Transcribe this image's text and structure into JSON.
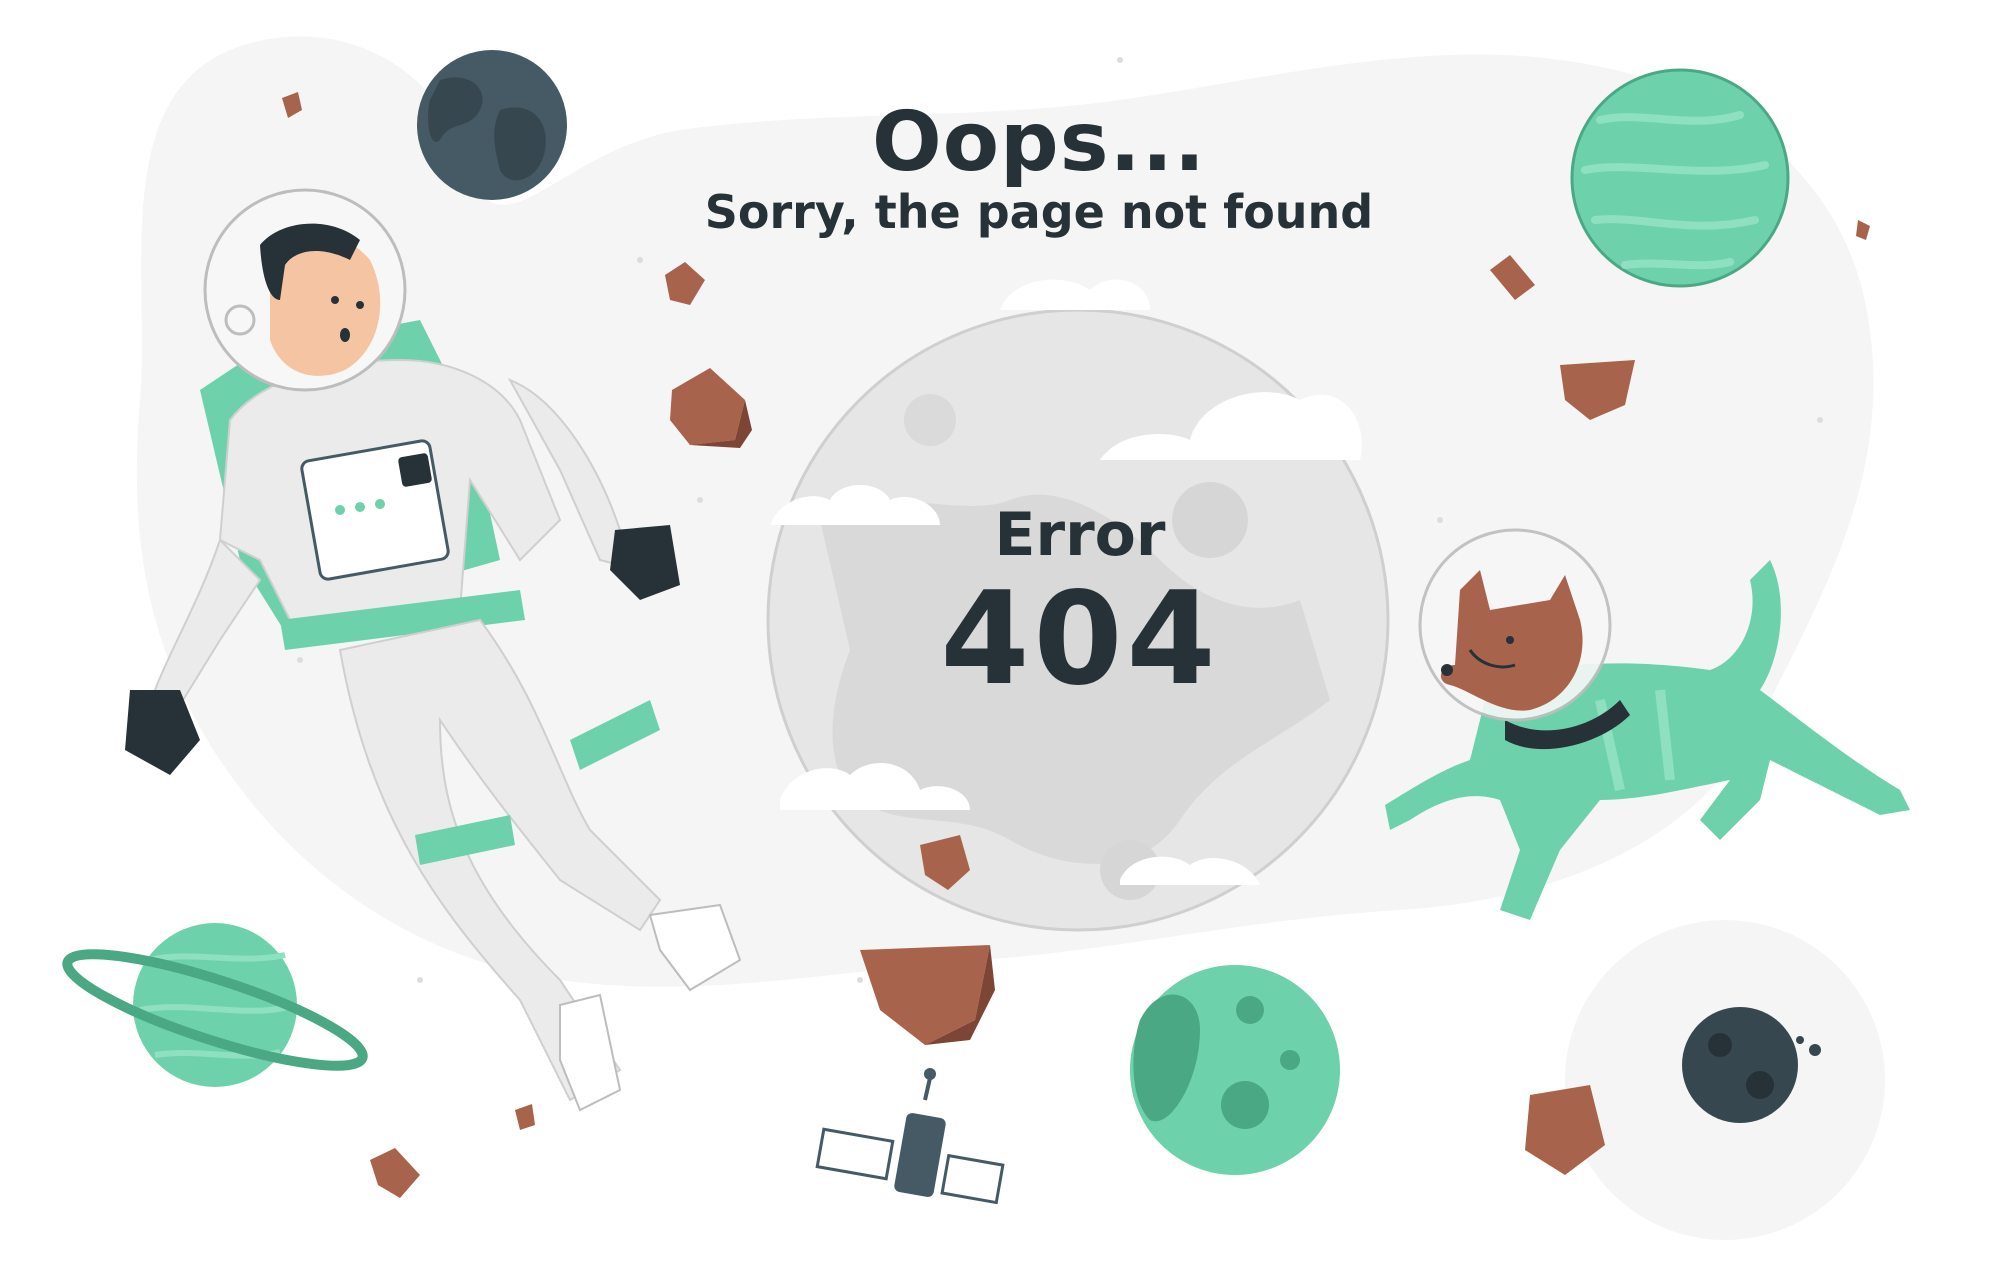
{
  "page": {
    "title": "Oops...",
    "subtitle": "Sorry, the page not found",
    "error_label": "Error",
    "error_code": "404"
  },
  "colors": {
    "text": "#263238",
    "accent_green": "#6dd2ab",
    "dark_green": "#4aa884",
    "rock": "#a8634c",
    "rock_dark": "#7d4535",
    "suit": "#ebebeb",
    "blob": "#f5f5f5",
    "moon": "#e6e6e6"
  },
  "icons": [
    "astronaut-illustration",
    "dog-astronaut-illustration",
    "moon-illustration",
    "planet-icon",
    "satellite-icon",
    "asteroid-icon"
  ]
}
